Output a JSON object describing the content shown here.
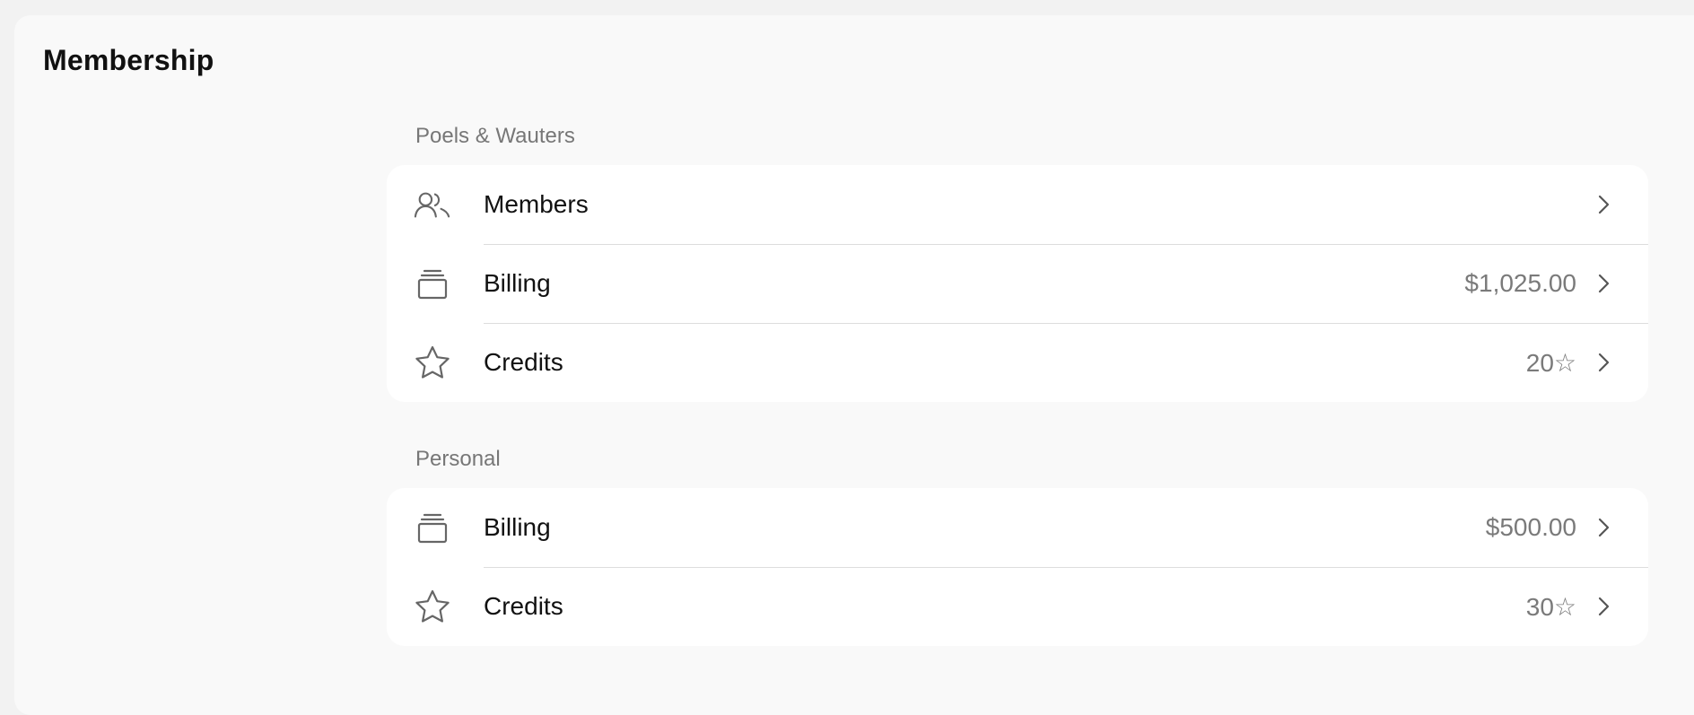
{
  "page": {
    "title": "Membership"
  },
  "sections": [
    {
      "label": "Poels & Wauters",
      "rows": [
        {
          "icon": "members-icon",
          "label": "Members",
          "value": ""
        },
        {
          "icon": "billing-icon",
          "label": "Billing",
          "value": "$1,025.00"
        },
        {
          "icon": "star-icon",
          "label": "Credits",
          "value": "20☆"
        }
      ]
    },
    {
      "label": "Personal",
      "rows": [
        {
          "icon": "billing-icon",
          "label": "Billing",
          "value": "$500.00"
        },
        {
          "icon": "star-icon",
          "label": "Credits",
          "value": "30☆"
        }
      ]
    }
  ],
  "colors": {
    "background": "#f2f2f2",
    "panel": "#f9f9f9",
    "card": "#ffffff",
    "text": "#111111",
    "muted": "#777777",
    "divider": "#dddddd",
    "icon": "#666666"
  }
}
